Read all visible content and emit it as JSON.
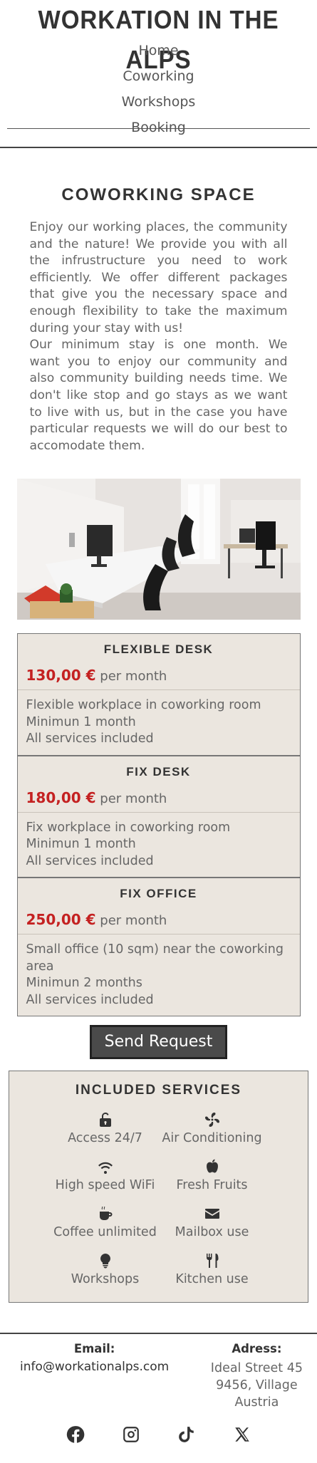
{
  "site": {
    "title": "WORKATION IN THE ALPS"
  },
  "nav": {
    "items": [
      "Home",
      "Coworking",
      "Workshops",
      "Booking"
    ]
  },
  "section": {
    "title": "COWORKING SPACE",
    "paragraph1": "Enjoy our working places, the community and the nature! We provide you with all the infrustructure you need to work efficiently. We offer different packages that give you the necessary space and enough flexibility to take the maximum during your stay with us!",
    "paragraph2": "Our minimum stay is one month. We want you to enjoy our community and also community building needs time. We don't like stop and go stays as we want to live with us, but in the case you have particular requests we will do our best to accomodate them."
  },
  "packages": [
    {
      "name": "FLEXIBLE DESK",
      "price": "130,00 €",
      "period": "per month",
      "lines": [
        "Flexible workplace in coworking room",
        "Minimun 1 month",
        "All services included"
      ]
    },
    {
      "name": "FIX DESK",
      "price": "180,00 €",
      "period": "per month",
      "lines": [
        "Fix workplace in coworking room",
        "Minimun 1 month",
        "All services included"
      ]
    },
    {
      "name": "FIX OFFICE",
      "price": "250,00 €",
      "period": "per month",
      "lines": [
        "Small office (10 sqm) near the coworking area",
        "Minimun 2 months",
        "All services included"
      ]
    }
  ],
  "cta": {
    "label": "Send Request"
  },
  "services": {
    "title": "INCLUDED SERVICES",
    "items": [
      {
        "label": "Access 24/7",
        "icon": "unlock-icon"
      },
      {
        "label": "Air Conditioning",
        "icon": "fan-icon"
      },
      {
        "label": "High speed WiFi",
        "icon": "wifi-icon"
      },
      {
        "label": "Fresh Fruits",
        "icon": "apple-icon"
      },
      {
        "label": "Coffee unlimited",
        "icon": "coffee-icon"
      },
      {
        "label": "Mailbox use",
        "icon": "envelope-icon"
      },
      {
        "label": "Workshops",
        "icon": "lightbulb-icon"
      },
      {
        "label": "Kitchen use",
        "icon": "utensils-icon"
      }
    ]
  },
  "footer": {
    "email_label": "Email:",
    "email": "info@workationalps.com",
    "address_label": "Adress:",
    "address_lines": [
      "Ideal Street 45",
      "9456, Village",
      "Austria"
    ],
    "socials": [
      "facebook-icon",
      "instagram-icon",
      "tiktok-icon",
      "x-icon"
    ]
  },
  "colors": {
    "price": "#c42121",
    "panel": "#ebe6df",
    "button": "#4a4a4a"
  }
}
